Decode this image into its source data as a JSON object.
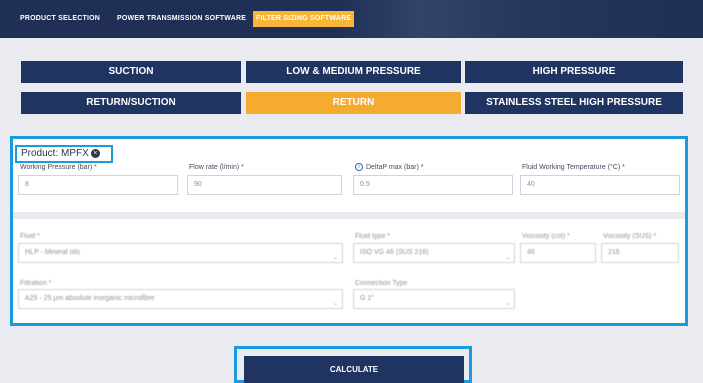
{
  "nav": {
    "tabs": [
      {
        "label": "PRODUCT SELECTION"
      },
      {
        "label": "POWER TRANSMISSION SOFTWARE"
      },
      {
        "label": "FILTER SIZING SOFTWARE"
      }
    ]
  },
  "categories": [
    {
      "label": "SUCTION"
    },
    {
      "label": "LOW & MEDIUM PRESSURE"
    },
    {
      "label": "HIGH PRESSURE"
    },
    {
      "label": "RETURN/SUCTION"
    },
    {
      "label": "RETURN"
    },
    {
      "label": "STAINLESS STEEL HIGH PRESSURE"
    }
  ],
  "product": {
    "label": "Product: MPFX",
    "close_glyph": "×"
  },
  "form": {
    "working_pressure": {
      "label": "Working Pressure (bar) *",
      "value": "8"
    },
    "flow_rate": {
      "label": "Flow rate (l/min) *",
      "value": "90"
    },
    "deltap": {
      "label": "DeltaP max (bar) *",
      "value": "0.5",
      "icon": "info-icon"
    },
    "fluid_temp": {
      "label": "Fluid Working Temperature (°C) *",
      "value": "40"
    },
    "fluid": {
      "label": "Fluid *",
      "value": "HLP - Mineral oils"
    },
    "fluid_type": {
      "label": "Fluid type *",
      "value": "ISO VG 46 (SUS 216)"
    },
    "viscosity_cst": {
      "label": "Viscosity (cst) *",
      "value": "46"
    },
    "viscosity_sus": {
      "label": "Viscosity (SUS) *",
      "value": "216"
    },
    "filtration": {
      "label": "Filtration *",
      "value": "A25 - 25 µm absolute inorganic microfibre"
    },
    "connection": {
      "label": "Connection Type",
      "value": "G 1\""
    }
  },
  "calculate": {
    "label": "CALCULATE"
  },
  "colors": {
    "navy": "#1f3460",
    "orange": "#f5aa30",
    "highlight": "#1b9bde"
  }
}
